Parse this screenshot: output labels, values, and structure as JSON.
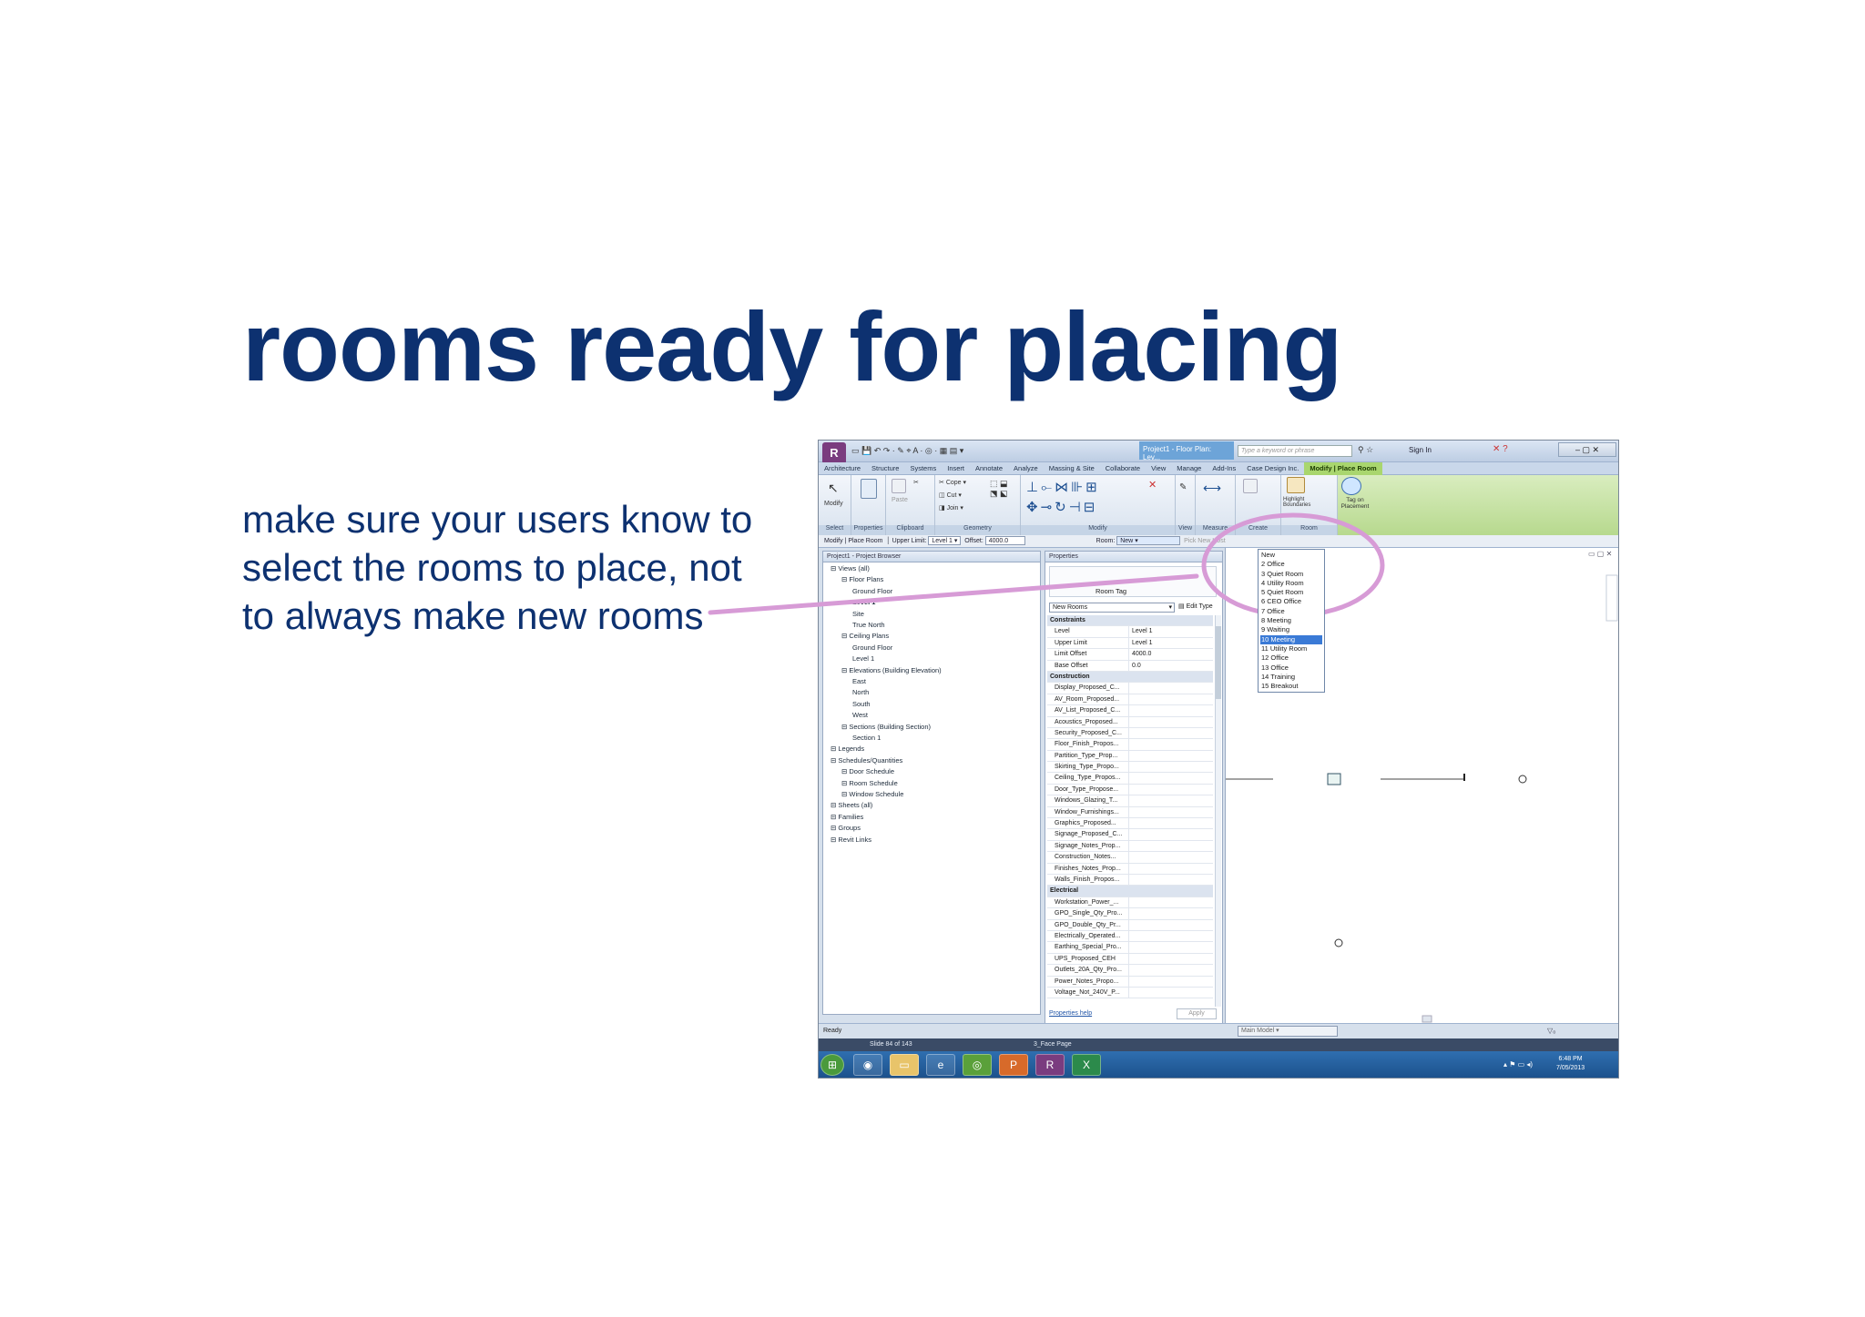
{
  "slide": {
    "title": "rooms ready for placing",
    "body": "make sure your users know to select the rooms to place, not to always make new rooms",
    "callout_color": "#d79bd6"
  },
  "revit": {
    "doc_title": "Project1 - Floor Plan: Lev...",
    "search_placeholder": "Type a keyword or phrase",
    "sign_in": "Sign In",
    "tabs": [
      "Architecture",
      "Structure",
      "Systems",
      "Insert",
      "Annotate",
      "Analyze",
      "Massing & Site",
      "Collaborate",
      "View",
      "Manage",
      "Add-Ins",
      "Case Design Inc.",
      "Modify | Place Room"
    ],
    "ribbon": {
      "modify": "Modify",
      "properties": "Properties",
      "paste": "Paste",
      "cope": "Cope",
      "cut": "Cut",
      "join": "Join",
      "tag_on_placement": "Tag on Placement",
      "highlight_boundaries": "Highlight Boundaries",
      "panels": [
        "Select",
        "Properties",
        "Clipboard",
        "Geometry",
        "Modify",
        "View",
        "Measure",
        "Create",
        "Room"
      ]
    },
    "options_bar": {
      "context": "Modify | Place Room",
      "upper_limit_label": "Upper Limit:",
      "upper_limit_value": "Level 1",
      "offset_label": "Offset:",
      "offset_value": "4000.0",
      "room_label": "Room:",
      "room_value": "New",
      "pick_new_host": "Pick New Host"
    },
    "project_browser": {
      "header": "Project1 - Project Browser",
      "items": [
        "Views (all)",
        "Floor Plans",
        "Ground Floor",
        "Level 1",
        "Site",
        "True North",
        "Ceiling Plans",
        "Ground Floor",
        "Level 1",
        "Elevations (Building Elevation)",
        "East",
        "North",
        "South",
        "West",
        "Sections (Building Section)",
        "Section 1",
        "Legends",
        "Schedules/Quantities",
        "Door Schedule",
        "Room Schedule",
        "Window Schedule",
        "Sheets (all)",
        "Families",
        "Groups",
        "Revit Links"
      ]
    },
    "properties": {
      "header": "Properties",
      "type_name": "Room Tag",
      "selector": "New Rooms",
      "edit_type": "Edit Type",
      "rows": [
        {
          "k": "Constraints",
          "v": "",
          "sec": true
        },
        {
          "k": "Level",
          "v": "Level 1"
        },
        {
          "k": "Upper Limit",
          "v": "Level 1"
        },
        {
          "k": "Limit Offset",
          "v": "4000.0"
        },
        {
          "k": "Base Offset",
          "v": "0.0"
        },
        {
          "k": "Construction",
          "v": "",
          "sec": true
        },
        {
          "k": "Display_Proposed_C...",
          "v": ""
        },
        {
          "k": "AV_Room_Proposed...",
          "v": ""
        },
        {
          "k": "AV_List_Proposed_C...",
          "v": ""
        },
        {
          "k": "Acoustics_Proposed...",
          "v": ""
        },
        {
          "k": "Security_Proposed_C...",
          "v": ""
        },
        {
          "k": "Floor_Finish_Propos...",
          "v": ""
        },
        {
          "k": "Partition_Type_Prop...",
          "v": ""
        },
        {
          "k": "Skirting_Type_Propo...",
          "v": ""
        },
        {
          "k": "Ceiling_Type_Propos...",
          "v": ""
        },
        {
          "k": "Door_Type_Propose...",
          "v": ""
        },
        {
          "k": "Windows_Glazing_T...",
          "v": ""
        },
        {
          "k": "Window_Furnishings...",
          "v": ""
        },
        {
          "k": "Graphics_Proposed...",
          "v": ""
        },
        {
          "k": "Signage_Proposed_C...",
          "v": ""
        },
        {
          "k": "Signage_Notes_Prop...",
          "v": ""
        },
        {
          "k": "Construction_Notes...",
          "v": ""
        },
        {
          "k": "Finishes_Notes_Prop...",
          "v": ""
        },
        {
          "k": "Walls_Finish_Propos...",
          "v": ""
        },
        {
          "k": "Electrical",
          "v": "",
          "sec": true
        },
        {
          "k": "Workstation_Power_...",
          "v": ""
        },
        {
          "k": "GPO_Single_Qty_Pro...",
          "v": ""
        },
        {
          "k": "GPO_Double_Qty_Pr...",
          "v": ""
        },
        {
          "k": "Electrically_Operated...",
          "v": ""
        },
        {
          "k": "Earthing_Special_Pro...",
          "v": ""
        },
        {
          "k": "UPS_Proposed_CEH",
          "v": ""
        },
        {
          "k": "Outlets_20A_Qty_Pro...",
          "v": ""
        },
        {
          "k": "Power_Notes_Propo...",
          "v": ""
        },
        {
          "k": "Voltage_Not_240V_P...",
          "v": ""
        }
      ],
      "help": "Properties help",
      "apply": "Apply"
    },
    "room_dropdown": [
      "New",
      "2  Office",
      "3  Quiet Room",
      "4  Utility Room",
      "5  Quiet Room",
      "6  CEO Office",
      "7  Office",
      "8  Meeting",
      "9  Waiting",
      "10  Meeting",
      "11  Utility Room",
      "12  Office",
      "13  Office",
      "14  Training",
      "15  Breakout"
    ],
    "room_selected_index": 9,
    "status": "Ready",
    "main_model": "Main Model",
    "ppt_status": "Slide 84 of 143",
    "ppt_theme": "3_Face Page",
    "clock_time": "6:48 PM",
    "clock_date": "7/05/2013"
  }
}
